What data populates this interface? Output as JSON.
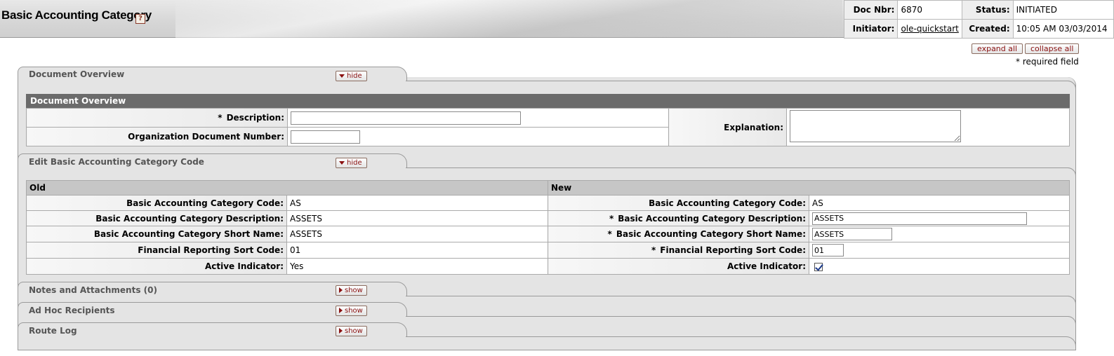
{
  "header": {
    "title": "Basic Accounting Category",
    "help_icon": "?",
    "doc_nbr_label": "Doc Nbr:",
    "doc_nbr": "6870",
    "status_label": "Status:",
    "status": "INITIATED",
    "initiator_label": "Initiator:",
    "initiator": "ole-quickstart",
    "created_label": "Created:",
    "created": "10:05 AM 03/03/2014"
  },
  "controls": {
    "expand_all": "expand all",
    "collapse_all": "collapse all",
    "required_note": "* required field"
  },
  "tabs": {
    "overview": {
      "title": "Document Overview",
      "toggle": "hide"
    },
    "edit": {
      "title": "Edit Basic Accounting Category Code",
      "toggle": "hide"
    },
    "notes": {
      "title": "Notes and Attachments (0)",
      "toggle": "show"
    },
    "adhoc": {
      "title": "Ad Hoc Recipients",
      "toggle": "show"
    },
    "routelog": {
      "title": "Route Log",
      "toggle": "show"
    }
  },
  "overview": {
    "section_title": "Document Overview",
    "required_marker": "*",
    "description_label": "Description:",
    "description_value": "",
    "org_doc_label": "Organization Document Number:",
    "org_doc_value": "",
    "explanation_label": "Explanation:",
    "explanation_value": ""
  },
  "edit": {
    "old_header": "Old",
    "new_header": "New",
    "required_marker": "*",
    "code_label": "Basic Accounting Category Code:",
    "desc_label": "Basic Accounting Category Description:",
    "short_label": "Basic Accounting Category Short Name:",
    "sort_label": "Financial Reporting Sort Code:",
    "active_label": "Active Indicator:",
    "old": {
      "code": "AS",
      "desc": "ASSETS",
      "short": "ASSETS",
      "sort": "01",
      "active": "Yes"
    },
    "new": {
      "code": "AS",
      "desc": "ASSETS",
      "short": "ASSETS",
      "sort": "01",
      "active": true
    }
  }
}
